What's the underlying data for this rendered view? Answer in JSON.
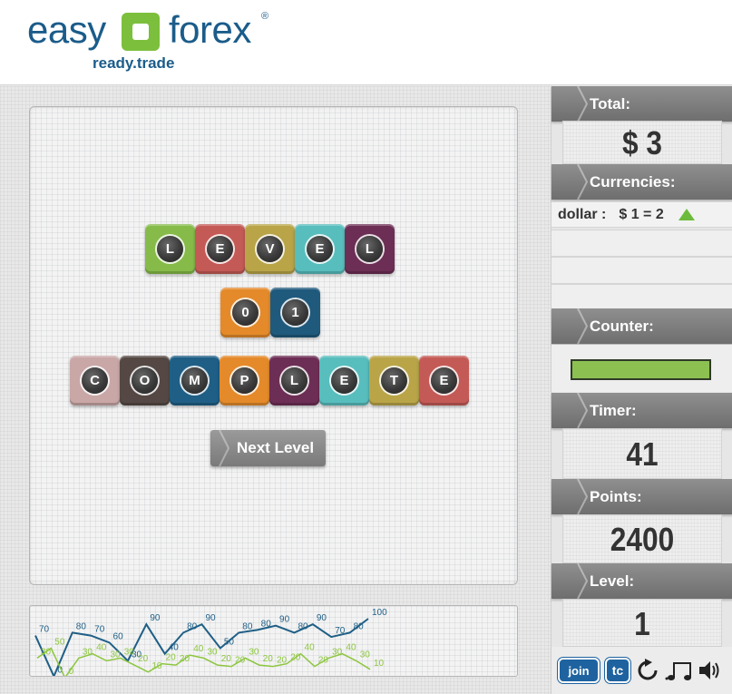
{
  "logo": {
    "word1": "easy",
    "word2": "forex",
    "reg": "®",
    "tagline": "ready.trade",
    "colors": {
      "text": "#1b5c8a",
      "box": "#7cbf3c"
    }
  },
  "game": {
    "rows": [
      {
        "tiles": [
          {
            "letter": "L",
            "color": "#86bb4a"
          },
          {
            "letter": "E",
            "color": "#c45a56"
          },
          {
            "letter": "V",
            "color": "#b9a548"
          },
          {
            "letter": "E",
            "color": "#58bdbd"
          },
          {
            "letter": "L",
            "color": "#6d2e55"
          }
        ]
      },
      {
        "tiles": [
          {
            "letter": "0",
            "color": "#e48a2a"
          },
          {
            "letter": "1",
            "color": "#1f5a7d"
          }
        ]
      },
      {
        "tiles": [
          {
            "letter": "C",
            "color": "#c9a7a7"
          },
          {
            "letter": "O",
            "color": "#554844"
          },
          {
            "letter": "M",
            "color": "#1f5f86"
          },
          {
            "letter": "P",
            "color": "#e48a2a"
          },
          {
            "letter": "L",
            "color": "#6d2e55"
          },
          {
            "letter": "E",
            "color": "#58bdbd"
          },
          {
            "letter": "T",
            "color": "#b9a548"
          },
          {
            "letter": "E",
            "color": "#c45a56"
          }
        ]
      }
    ],
    "next_level_label": "Next Level"
  },
  "chart_data": {
    "type": "line",
    "series": [
      {
        "color": "#1f5f86",
        "labels": [
          "70",
          "0",
          "80",
          "70",
          "60",
          "30",
          "90",
          "40",
          "80",
          "90",
          "50",
          "80",
          "80",
          "90",
          "80",
          "90",
          "70",
          "80",
          "100"
        ]
      },
      {
        "color": "#8dc63f",
        "labels": [
          "30",
          "50",
          "0",
          "30",
          "40",
          "30",
          "30",
          "20",
          "10",
          "20",
          "20",
          "40",
          "30",
          "20",
          "20",
          "30",
          "20",
          "20",
          "20",
          "40",
          "20",
          "30",
          "40",
          "30",
          "10"
        ]
      }
    ]
  },
  "sidebar": {
    "total": {
      "label": "Total:",
      "value": "$ 3"
    },
    "currencies": {
      "label": "Currencies:",
      "items": [
        {
          "name": "dollar :",
          "rate": "$ 1 =  2",
          "trend": "up"
        }
      ]
    },
    "counter": {
      "label": "Counter:",
      "progress": 1.0,
      "fill_color": "#8cc152"
    },
    "timer": {
      "label": "Timer:",
      "value": "41"
    },
    "points": {
      "label": "Points:",
      "value": "2400"
    },
    "level": {
      "label": "Level:",
      "value": "1"
    },
    "footer": {
      "join": "join",
      "tc": "tc"
    }
  }
}
